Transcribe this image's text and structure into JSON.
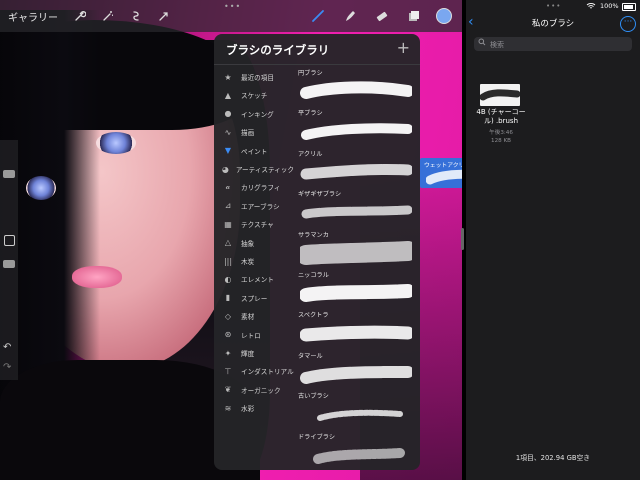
{
  "toolbar": {
    "gallery_label": "ギャラリー",
    "left_icons": [
      "wrench-icon",
      "magic-wand-icon",
      "selection-icon",
      "transform-icon"
    ],
    "right_icons": [
      "brush-icon",
      "smudge-icon",
      "eraser-icon",
      "layers-icon"
    ],
    "color_swatch": "#7aa7f0"
  },
  "brush_library": {
    "title": "ブラシのライブラリ",
    "add_label": "+",
    "sets": [
      {
        "label": "最近の項目",
        "icon": "star-icon"
      },
      {
        "label": "スケッチ",
        "icon": "pencil-tip-icon"
      },
      {
        "label": "インキング",
        "icon": "ink-drop-icon"
      },
      {
        "label": "描画",
        "icon": "squiggle-icon"
      },
      {
        "label": "ペイント",
        "icon": "paint-brush-icon"
      },
      {
        "label": "アーティスティック",
        "icon": "palette-icon"
      },
      {
        "label": "カリグラフィ",
        "icon": "calligraphy-icon"
      },
      {
        "label": "エアーブラシ",
        "icon": "airbrush-icon"
      },
      {
        "label": "テクスチャ",
        "icon": "texture-icon"
      },
      {
        "label": "抽象",
        "icon": "triangle-icon"
      },
      {
        "label": "木炭",
        "icon": "charcoal-icon"
      },
      {
        "label": "エレメント",
        "icon": "yin-yang-icon"
      },
      {
        "label": "スプレー",
        "icon": "spray-can-icon"
      },
      {
        "label": "素材",
        "icon": "cube-icon"
      },
      {
        "label": "レトロ",
        "icon": "retro-icon"
      },
      {
        "label": "輝度",
        "icon": "sparkle-icon"
      },
      {
        "label": "インダストリアル",
        "icon": "anvil-icon"
      },
      {
        "label": "オーガニック",
        "icon": "leaf-icon"
      },
      {
        "label": "水彩",
        "icon": "waves-icon"
      }
    ],
    "brushes": [
      {
        "label": "円ブラシ"
      },
      {
        "label": "平ブラシ"
      },
      {
        "label": "アクリル"
      },
      {
        "label": "ギザギザブラシ"
      },
      {
        "label": "サラマンカ"
      },
      {
        "label": "ニッコラル"
      },
      {
        "label": "スペクトラ"
      },
      {
        "label": "タマール"
      },
      {
        "label": "古いブラシ"
      },
      {
        "label": "ドライブラシ"
      }
    ],
    "dragged_brush": {
      "label": "ウェットアクリル",
      "add_badge": "+"
    }
  },
  "files": {
    "title": "私のブラシ",
    "status": {
      "wifi": "WiFi",
      "battery": "100%"
    },
    "search_placeholder": "検索",
    "item": {
      "name": "4B (チャーコール) .brush",
      "time": "午後3:46",
      "size": "128 KB"
    },
    "footer": "1項目、202.94 GB空き",
    "back_label": "‹",
    "more_label": "···"
  }
}
